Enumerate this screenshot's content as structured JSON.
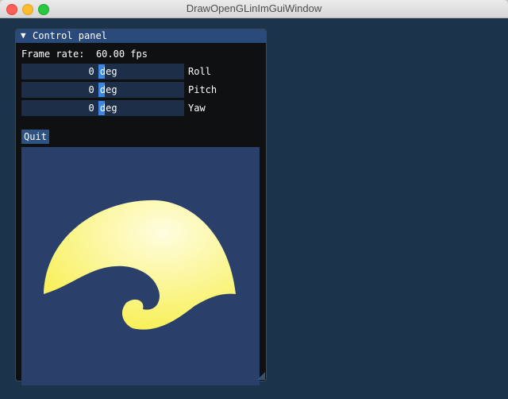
{
  "window": {
    "title": "DrawOpenGLinImGuiWindow"
  },
  "panel": {
    "title": "Control panel",
    "frame_rate_label": "Frame rate:",
    "frame_rate_value": "60.00 fps",
    "sliders": [
      {
        "value": "0 deg",
        "label": "Roll"
      },
      {
        "value": "0 deg",
        "label": "Pitch"
      },
      {
        "value": "0 deg",
        "label": "Yaw"
      }
    ],
    "quit_label": "Quit"
  },
  "colors": {
    "background": "#1c334c",
    "canvas": "#2a3f69",
    "shape_light": "#fffde0",
    "shape_dark": "#f8f05a"
  }
}
